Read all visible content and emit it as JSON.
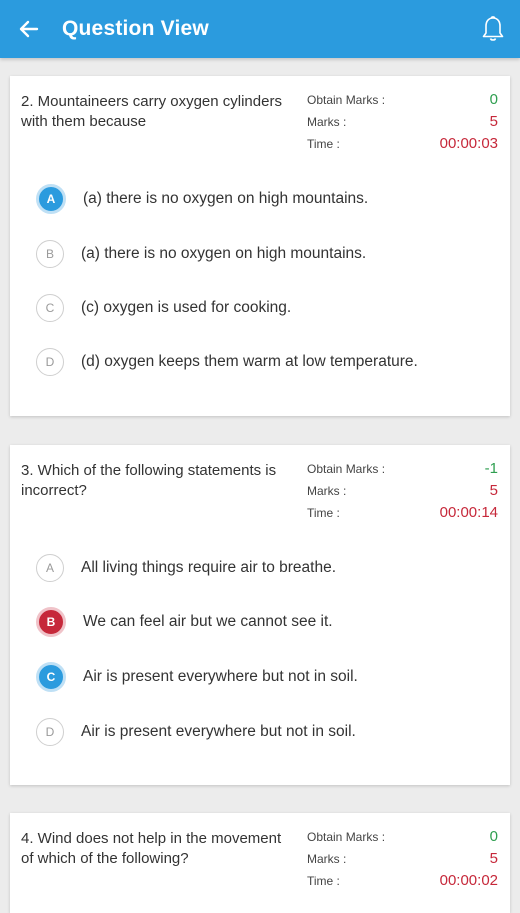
{
  "appbar": {
    "title": "Question View",
    "back_icon": "arrow-left-icon",
    "bell_icon": "bell-icon",
    "background": "#2b9bde"
  },
  "labels": {
    "obtain_marks": "Obtain Marks :",
    "marks": "Marks :",
    "time": "Time :"
  },
  "questions": [
    {
      "text": "2. Mountaineers carry oxygen cylinders with them because",
      "obtain_marks": "0",
      "marks": "5",
      "time": "00:00:03",
      "options": [
        {
          "letter": "A",
          "text": "(a) there is no oxygen on high mountains.",
          "state": "selected-correct"
        },
        {
          "letter": "B",
          "text": "(a) there is no oxygen on high mountains.",
          "state": "none"
        },
        {
          "letter": "C",
          "text": "(c) oxygen is used for cooking.",
          "state": "none"
        },
        {
          "letter": "D",
          "text": "(d) oxygen keeps them warm at low temperature.",
          "state": "none"
        }
      ]
    },
    {
      "text": "3. Which of the following statements is incorrect?",
      "obtain_marks": "-1",
      "marks": "5",
      "time": "00:00:14",
      "options": [
        {
          "letter": "A",
          "text": "All living things require air to breathe.",
          "state": "none"
        },
        {
          "letter": "B",
          "text": "We can feel air but we cannot see it.",
          "state": "selected-wrong"
        },
        {
          "letter": "C",
          "text": "Air is present everywhere but not in soil.",
          "state": "correct"
        },
        {
          "letter": "D",
          "text": "Air is present everywhere but not in soil.",
          "state": "none"
        }
      ]
    },
    {
      "text": "4. Wind does not help in the movement of which of the following?",
      "obtain_marks": "0",
      "marks": "5",
      "time": "00:00:02"
    }
  ],
  "colors": {
    "correct": "#2b9bde",
    "wrong": "#c6283a",
    "positive_marks": "#2e9e4f",
    "negative_marks": "#c6283a"
  }
}
